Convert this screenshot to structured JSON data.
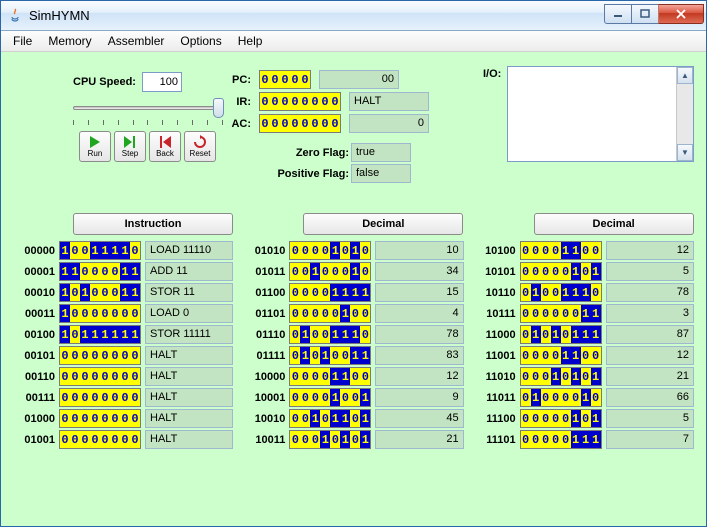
{
  "window": {
    "title": "SimHYMN"
  },
  "menu": [
    "File",
    "Memory",
    "Assembler",
    "Options",
    "Help"
  ],
  "cpu": {
    "speed_label": "CPU Speed:",
    "speed_value": "100",
    "buttons": {
      "run": "Run",
      "step": "Step",
      "back": "Back",
      "reset": "Reset"
    }
  },
  "registers": {
    "pc": {
      "label": "PC:",
      "bits": "00000",
      "value": "00"
    },
    "ir": {
      "label": "IR:",
      "bits": "00000000",
      "text": "HALT"
    },
    "ac": {
      "label": "AC:",
      "bits": "00000000",
      "value": "0"
    },
    "flags": {
      "zero_label": "Zero Flag:",
      "zero_value": "true",
      "pos_label": "Positive Flag:",
      "pos_value": "false"
    }
  },
  "io": {
    "label": "I/O:"
  },
  "columns": {
    "instruction": "Instruction",
    "decimal": "Decimal"
  },
  "memory": [
    {
      "addr": "00000",
      "bits": "10011110",
      "instr": "LOAD 11110"
    },
    {
      "addr": "00001",
      "bits": "11000011",
      "instr": "ADD 11"
    },
    {
      "addr": "00010",
      "bits": "10100011",
      "instr": "STOR 11"
    },
    {
      "addr": "00011",
      "bits": "10000000",
      "instr": "LOAD 0"
    },
    {
      "addr": "00100",
      "bits": "10111111",
      "instr": "STOR 11111"
    },
    {
      "addr": "00101",
      "bits": "00000000",
      "instr": "HALT"
    },
    {
      "addr": "00110",
      "bits": "00000000",
      "instr": "HALT"
    },
    {
      "addr": "00111",
      "bits": "00000000",
      "instr": "HALT"
    },
    {
      "addr": "01000",
      "bits": "00000000",
      "instr": "HALT"
    },
    {
      "addr": "01001",
      "bits": "00000000",
      "instr": "HALT"
    },
    {
      "addr": "01010",
      "bits": "00001010",
      "dec": "10"
    },
    {
      "addr": "01011",
      "bits": "00100010",
      "dec": "34"
    },
    {
      "addr": "01100",
      "bits": "00001111",
      "dec": "15"
    },
    {
      "addr": "01101",
      "bits": "00000100",
      "dec": "4"
    },
    {
      "addr": "01110",
      "bits": "01001110",
      "dec": "78"
    },
    {
      "addr": "01111",
      "bits": "01010011",
      "dec": "83"
    },
    {
      "addr": "10000",
      "bits": "00001100",
      "dec": "12"
    },
    {
      "addr": "10001",
      "bits": "00001001",
      "dec": "9"
    },
    {
      "addr": "10010",
      "bits": "00101101",
      "dec": "45"
    },
    {
      "addr": "10011",
      "bits": "00010101",
      "dec": "21"
    },
    {
      "addr": "10100",
      "bits": "00001100",
      "dec": "12"
    },
    {
      "addr": "10101",
      "bits": "00000101",
      "dec": "5"
    },
    {
      "addr": "10110",
      "bits": "01001110",
      "dec": "78"
    },
    {
      "addr": "10111",
      "bits": "00000011",
      "dec": "3"
    },
    {
      "addr": "11000",
      "bits": "01010111",
      "dec": "87"
    },
    {
      "addr": "11001",
      "bits": "00001100",
      "dec": "12"
    },
    {
      "addr": "11010",
      "bits": "00010101",
      "dec": "21"
    },
    {
      "addr": "11011",
      "bits": "01000010",
      "dec": "66"
    },
    {
      "addr": "11100",
      "bits": "00000101",
      "dec": "5"
    },
    {
      "addr": "11101",
      "bits": "00000111",
      "dec": "7"
    }
  ]
}
